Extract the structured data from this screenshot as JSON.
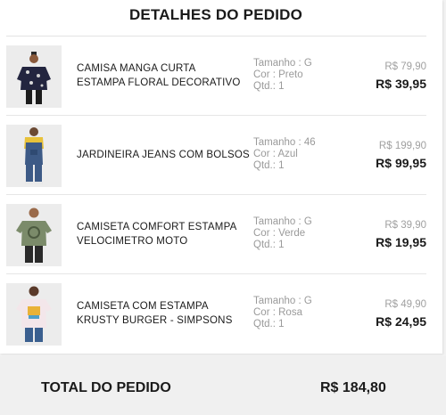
{
  "order": {
    "title": "DETALHES DO PEDIDO",
    "items": [
      {
        "name_line1": "CAMISA MANGA CURTA",
        "name_line2": "ESTAMPA FLORAL DECORATIVO",
        "size": "Tamanho : G",
        "color": "Cor : Preto",
        "qty": "Qtd.: 1",
        "price_old": "R$ 79,90",
        "price_new": "R$ 39,95",
        "image_icon": "product-floral-shirt"
      },
      {
        "name_line1": "JARDINEIRA JEANS COM BOLSOS",
        "name_line2": "",
        "size": "Tamanho : 46",
        "color": "Cor : Azul",
        "qty": "Qtd.: 1",
        "price_old": "R$ 199,90",
        "price_new": "R$ 99,95",
        "image_icon": "product-denim-overalls"
      },
      {
        "name_line1": "CAMISETA COMFORT ESTAMPA",
        "name_line2": "VELOCIMETRO MOTO",
        "size": "Tamanho : G",
        "color": "Cor : Verde",
        "qty": "Qtd.: 1",
        "price_old": "R$ 39,90",
        "price_new": "R$ 19,95",
        "image_icon": "product-green-tshirt"
      },
      {
        "name_line1": "CAMISETA COM ESTAMPA",
        "name_line2": "KRUSTY BURGER - SIMPSONS",
        "size": "Tamanho : G",
        "color": "Cor : Rosa",
        "qty": "Qtd.: 1",
        "price_old": "R$ 49,90",
        "price_new": "R$ 24,95",
        "image_icon": "product-pink-tshirt"
      }
    ]
  },
  "total": {
    "label": "TOTAL DO PEDIDO",
    "value": "R$ 184,80"
  },
  "colors": {
    "text": "#1a1a1a",
    "muted": "#9a9a9a",
    "total_bg": "#f0f0f0"
  }
}
